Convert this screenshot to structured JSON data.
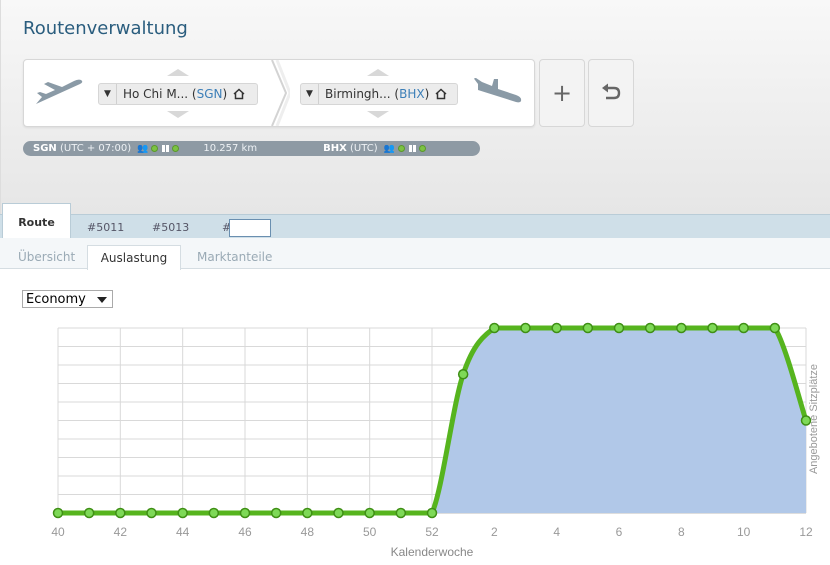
{
  "app": {
    "title": "Routenverwaltung"
  },
  "route": {
    "departure": {
      "name": "Ho Chi M...",
      "code": "SGN"
    },
    "arrival": {
      "name": "Birmingh...",
      "code": "BHX"
    },
    "add_label": "+",
    "undo_icon": "undo-icon"
  },
  "info": {
    "dep_code": "SGN",
    "dep_tz": "(UTC + 07:00)",
    "distance": "10.257 km",
    "arr_code": "BHX",
    "arr_tz": "(UTC)"
  },
  "tabs": {
    "route": "Route",
    "t1": "#5011",
    "t2": "#5013",
    "hash": "#"
  },
  "subtabs": {
    "uebersicht": "Übersicht",
    "auslastung": "Auslastung",
    "marktanteile": "Marktanteile"
  },
  "class_select": {
    "value": "Economy"
  },
  "colors": {
    "accent_title": "#2a5d7e",
    "line": "#56b41e",
    "area": "#b1c8e8",
    "code_blue": "#3c7fb8"
  },
  "chart_data": {
    "type": "area",
    "xlabel": "Kalenderwoche",
    "ylabel": "Angebotene Sitzplätze",
    "x_tick_labels": [
      "40",
      "42",
      "44",
      "46",
      "48",
      "50",
      "52",
      "2",
      "4",
      "6",
      "8",
      "10",
      "12"
    ],
    "x": [
      "40",
      "41",
      "42",
      "43",
      "44",
      "45",
      "46",
      "47",
      "48",
      "49",
      "50",
      "51",
      "52",
      "1",
      "2",
      "3",
      "4",
      "5",
      "6",
      "7",
      "8",
      "9",
      "10",
      "11",
      "12"
    ],
    "values": [
      0,
      0,
      0,
      0,
      0,
      0,
      0,
      0,
      0,
      0,
      0,
      0,
      0,
      7.5,
      10,
      10,
      10,
      10,
      10,
      10,
      10,
      10,
      10,
      10,
      5
    ],
    "ylim": [
      0,
      10
    ],
    "grid": true,
    "y_tick_labels_shown": false
  }
}
